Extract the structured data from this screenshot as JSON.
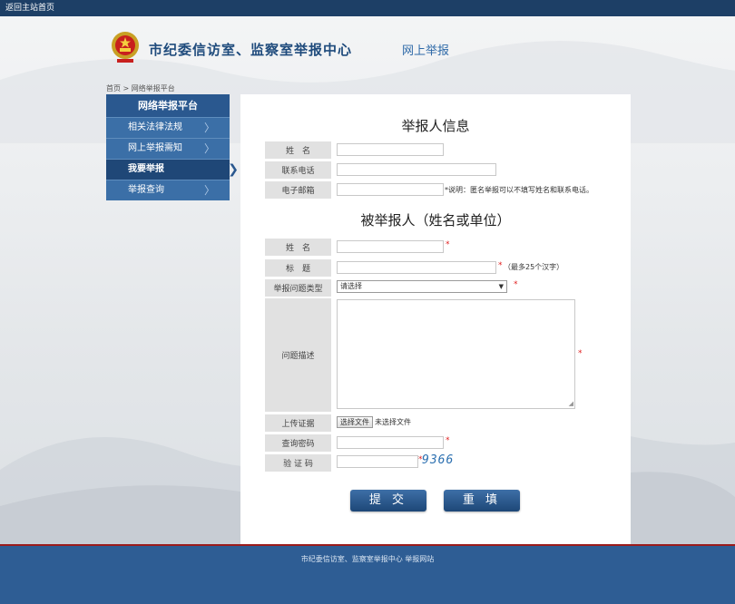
{
  "topbar": {
    "home_link": "返回主站首页"
  },
  "header": {
    "title": "市纪委信访室、监察室举报中心",
    "subtitle": "网上举报"
  },
  "breadcrumb": "首页 > 网络举报平台",
  "sidebar": {
    "heading": "网络举报平台",
    "items": [
      {
        "label": "相关法律法规"
      },
      {
        "label": "网上举报需知"
      },
      {
        "label": "我要举报"
      },
      {
        "label": "举报查询"
      }
    ]
  },
  "reporter": {
    "title": "举报人信息",
    "name_label": "姓　名",
    "phone_label": "联系电话",
    "email_label": "电子邮箱",
    "email_note": "*说明：匿名举报可以不填写姓名和联系电话。"
  },
  "reported": {
    "title": "被举报人（姓名或单位）",
    "name_label": "姓　名",
    "subject_label": "标　题",
    "subject_note": "（最多25个汉字）",
    "type_label": "举报问题类型",
    "type_selected": "请选择",
    "desc_label": "问题描述",
    "upload_label": "上传证据",
    "upload_button": "选择文件",
    "upload_status": "未选择文件",
    "query_pwd_label": "查询密码",
    "captcha_label": "验 证 码",
    "captcha_text": "9366"
  },
  "buttons": {
    "submit": "提 交",
    "reset": "重 填"
  },
  "footer": {
    "text": "市纪委信访室、监察室举报中心 举报网站"
  },
  "colors": {
    "brand": "#1d3f66",
    "accent": "#2a588f",
    "required": "#e02020"
  }
}
